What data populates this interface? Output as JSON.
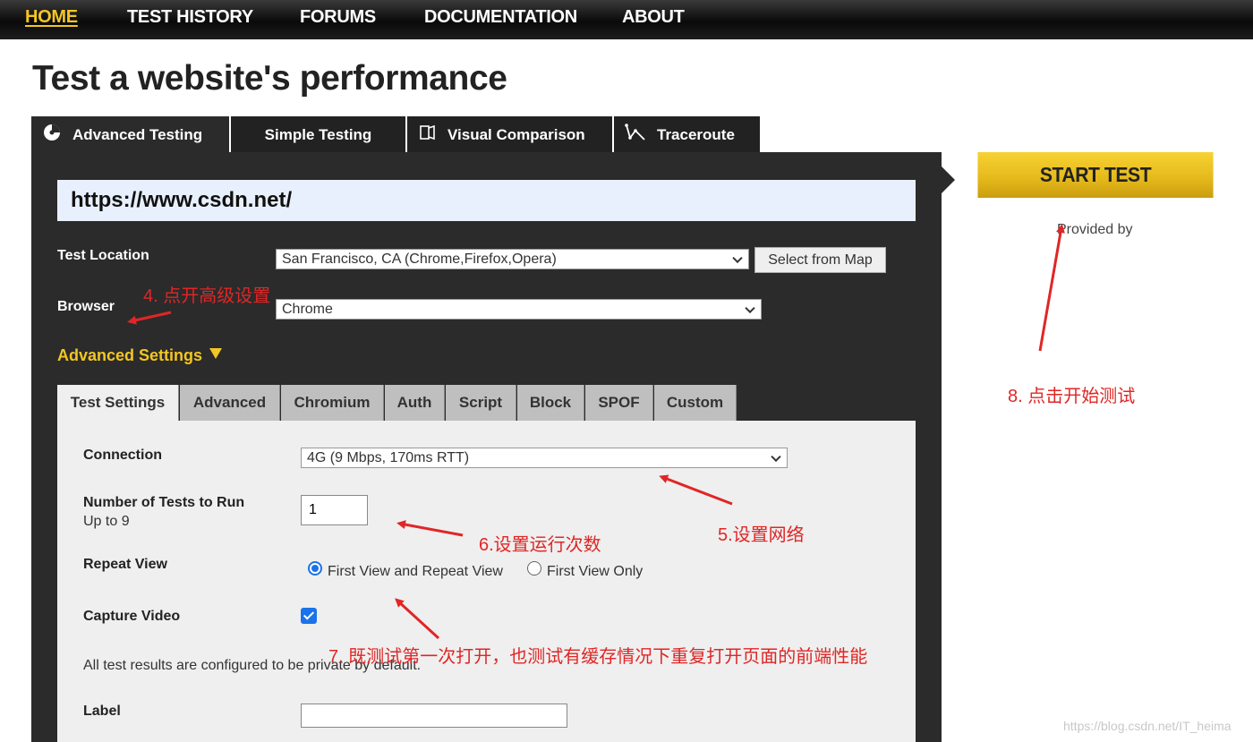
{
  "nav": {
    "items": [
      "HOME",
      "TEST HISTORY",
      "FORUMS",
      "DOCUMENTATION",
      "ABOUT"
    ]
  },
  "page_title": "Test a website's performance",
  "main_tabs": {
    "advanced": "Advanced Testing",
    "simple": "Simple Testing",
    "visual": "Visual Comparison",
    "traceroute": "Traceroute"
  },
  "url_value": "https://www.csdn.net/",
  "test_location": {
    "label": "Test Location",
    "value": "San Francisco, CA (Chrome,Firefox,Opera)",
    "map_button": "Select from Map"
  },
  "browser": {
    "label": "Browser",
    "value": "Chrome"
  },
  "advanced_settings_label": "Advanced Settings",
  "sub_tabs": [
    "Test Settings",
    "Advanced",
    "Chromium",
    "Auth",
    "Script",
    "Block",
    "SPOF",
    "Custom"
  ],
  "settings": {
    "connection_label": "Connection",
    "connection_value": "4G (9 Mbps, 170ms RTT)",
    "num_tests_label": "Number of Tests to Run",
    "num_tests_sub": "Up to 9",
    "num_tests_value": "1",
    "repeat_view_label": "Repeat View",
    "repeat_option_1": "First View and Repeat View",
    "repeat_option_2": "First View Only",
    "capture_video_label": "Capture Video",
    "capture_video_checked": true,
    "private_note": "All test results are configured to be private by default.",
    "label_label": "Label",
    "label_value": ""
  },
  "start_button": "START TEST",
  "provided_by": "Provided by",
  "annotations": {
    "step4": "4. 点开高级设置",
    "step5": "5.设置网络",
    "step6": "6.设置运行次数",
    "step7": "7. 既测试第一次打开，也测试有缓存情况下重复打开页面的前端性能",
    "step8": "8. 点击开始测试"
  },
  "watermark": "https://blog.csdn.net/IT_heima",
  "colors": {
    "accent": "#f3c623",
    "panel_dark": "#2b2b2b",
    "annotation_red": "#e02626",
    "url_bg": "#e8f0fd"
  }
}
